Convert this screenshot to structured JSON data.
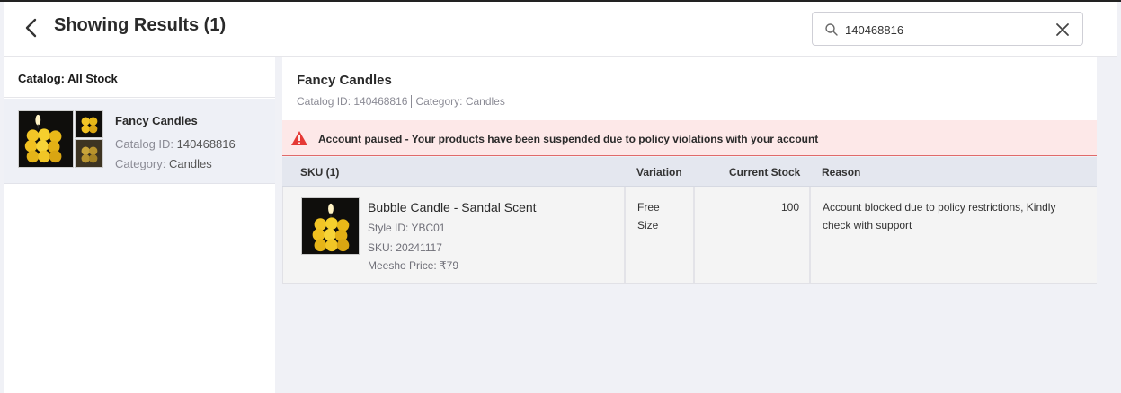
{
  "header": {
    "title": "Showing Results (1)",
    "back_icon": "chevron-left-icon",
    "search": {
      "value": "140468816",
      "placeholder": "",
      "search_icon": "search-icon",
      "clear_icon": "close-icon"
    }
  },
  "sidebar": {
    "catalog_heading": "Catalog: All Stock",
    "items": [
      {
        "name": "Fancy Candles",
        "catalog_id_label": "Catalog ID:",
        "catalog_id": "140468816",
        "category_label": "Category:",
        "category": "Candles"
      }
    ]
  },
  "main": {
    "title": "Fancy Candles",
    "catalog_id_label": "Catalog ID:",
    "catalog_id": "140468816",
    "category_label": "Category:",
    "category": "Candles"
  },
  "alert": {
    "icon": "warning-triangle-icon",
    "color": "#e53935",
    "text": "Account paused - Your products have been suspended due to policy violations with your account"
  },
  "table": {
    "headers": {
      "sku": "SKU (1)",
      "variation": "Variation",
      "stock": "Current Stock",
      "reason": "Reason"
    },
    "rows": [
      {
        "name": "Bubble Candle - Sandal Scent",
        "style_id": "Style ID:  YBC01",
        "sku": "SKU:  20241117",
        "price": "Meesho Price: ₹79",
        "variation_line1": "Free",
        "variation_line2": "Size",
        "stock": "100",
        "reason_line1": "Account blocked due to policy restrictions, Kindly",
        "reason_line2": "check with support"
      }
    ]
  },
  "colors": {
    "page_bg": "#f0f1f6",
    "alert_bg": "#fde8e8",
    "alert_border": "#e06a6a",
    "table_header_bg": "#e4e7ef",
    "selected_item_bg": "#eef0f6"
  }
}
